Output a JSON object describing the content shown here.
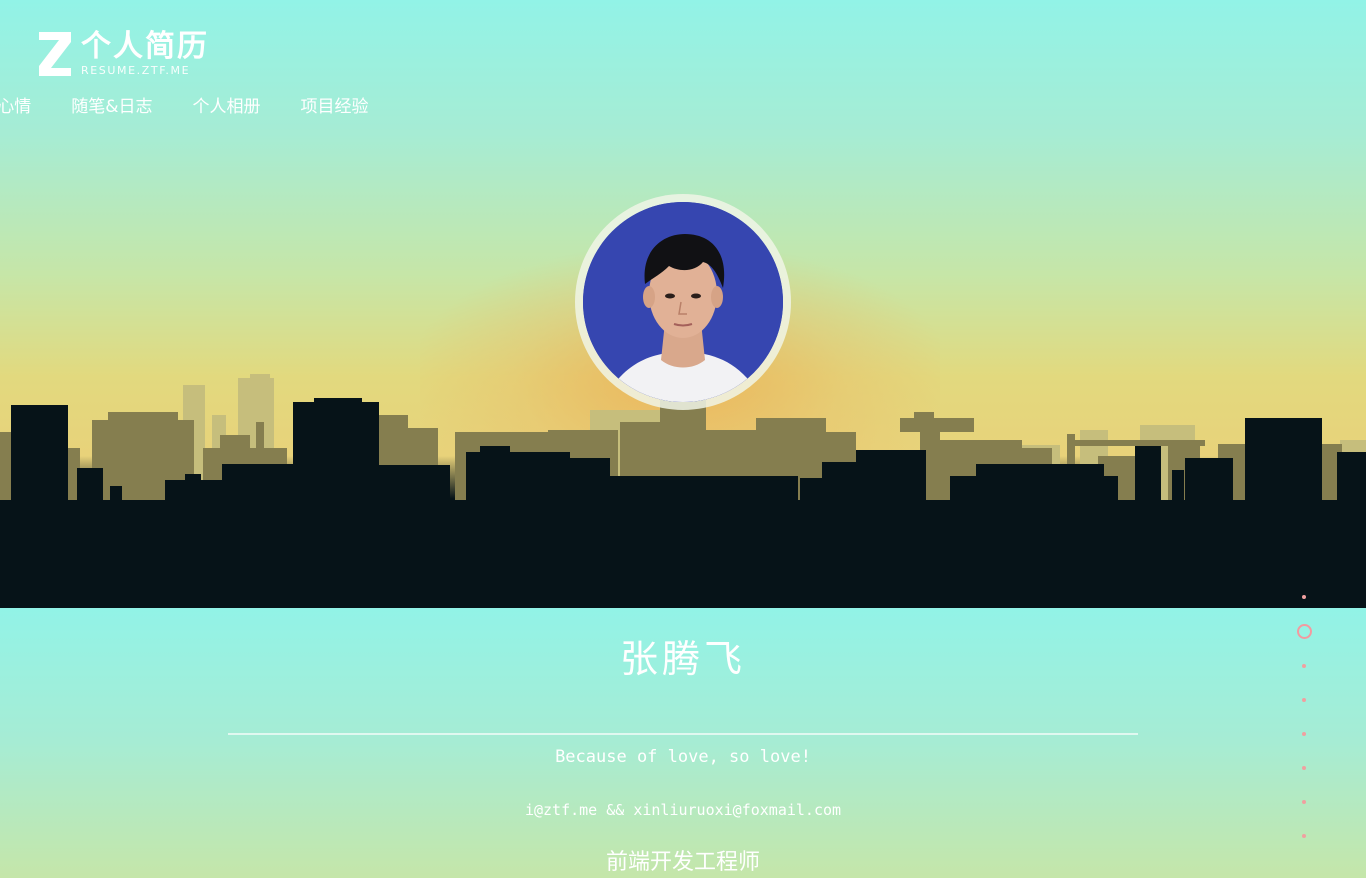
{
  "brand": {
    "title": "个人简历",
    "subtitle": "RESUME.ZTF.ME",
    "logo_icon": "z-logo-icon"
  },
  "nav": {
    "items": [
      {
        "label": "冒泡&心情"
      },
      {
        "label": "随笔&日志"
      },
      {
        "label": "个人相册"
      },
      {
        "label": "项目经验"
      }
    ]
  },
  "profile": {
    "name": "张腾飞",
    "motto": "Because of love, so love!",
    "email": "i@ztf.me && xinliuruoxi@foxmail.com",
    "job_title": "前端开发工程师",
    "avatar_icon": "avatar-photo"
  },
  "page_dots": {
    "count": 8,
    "active_index": 1
  },
  "colors": {
    "sky_top": "#92f3e7",
    "sky_bottom": "#e8d27a",
    "skyline_far": "#b9b371",
    "skyline_mid": "#857e4f",
    "skyline_near": "#061318",
    "dot_accent": "#f39aa0"
  }
}
